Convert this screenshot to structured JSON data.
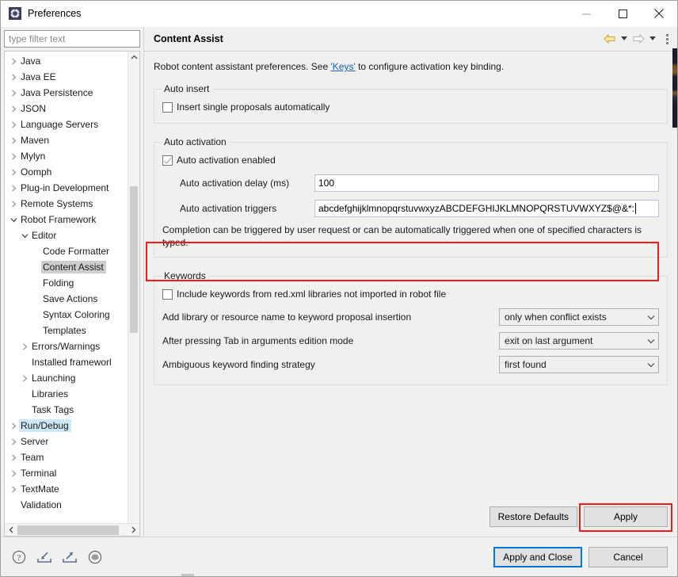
{
  "window": {
    "title": "Preferences",
    "icon": "gear-icon",
    "controls": {
      "minimize": "—",
      "maximize": "□",
      "close": "✕"
    }
  },
  "sidebar": {
    "filter": {
      "placeholder": "type filter text",
      "value": ""
    },
    "items": [
      {
        "label": "Java",
        "indent": 0,
        "twisty": "collapsed",
        "state": "normal"
      },
      {
        "label": "Java EE",
        "indent": 0,
        "twisty": "collapsed",
        "state": "normal"
      },
      {
        "label": "Java Persistence",
        "indent": 0,
        "twisty": "collapsed",
        "state": "normal"
      },
      {
        "label": "JSON",
        "indent": 0,
        "twisty": "collapsed",
        "state": "normal"
      },
      {
        "label": "Language Servers",
        "indent": 0,
        "twisty": "collapsed",
        "state": "normal"
      },
      {
        "label": "Maven",
        "indent": 0,
        "twisty": "collapsed",
        "state": "normal"
      },
      {
        "label": "Mylyn",
        "indent": 0,
        "twisty": "collapsed",
        "state": "normal"
      },
      {
        "label": "Oomph",
        "indent": 0,
        "twisty": "collapsed",
        "state": "normal"
      },
      {
        "label": "Plug-in Development",
        "indent": 0,
        "twisty": "collapsed",
        "state": "normal"
      },
      {
        "label": "Remote Systems",
        "indent": 0,
        "twisty": "collapsed",
        "state": "normal"
      },
      {
        "label": "Robot Framework",
        "indent": 0,
        "twisty": "expanded",
        "state": "normal"
      },
      {
        "label": "Editor",
        "indent": 1,
        "twisty": "expanded",
        "state": "normal"
      },
      {
        "label": "Code Formatter",
        "indent": 2,
        "twisty": "none",
        "state": "normal"
      },
      {
        "label": "Content Assist",
        "indent": 2,
        "twisty": "none",
        "state": "selected"
      },
      {
        "label": "Folding",
        "indent": 2,
        "twisty": "none",
        "state": "normal"
      },
      {
        "label": "Save Actions",
        "indent": 2,
        "twisty": "none",
        "state": "normal"
      },
      {
        "label": "Syntax Coloring",
        "indent": 2,
        "twisty": "none",
        "state": "normal"
      },
      {
        "label": "Templates",
        "indent": 2,
        "twisty": "none",
        "state": "normal"
      },
      {
        "label": "Errors/Warnings",
        "indent": 1,
        "twisty": "collapsed",
        "state": "normal"
      },
      {
        "label": "Installed frameworl",
        "indent": 1,
        "twisty": "none",
        "state": "normal"
      },
      {
        "label": "Launching",
        "indent": 1,
        "twisty": "collapsed",
        "state": "normal"
      },
      {
        "label": "Libraries",
        "indent": 1,
        "twisty": "none",
        "state": "normal"
      },
      {
        "label": "Task Tags",
        "indent": 1,
        "twisty": "none",
        "state": "normal"
      },
      {
        "label": "Run/Debug",
        "indent": 0,
        "twisty": "collapsed",
        "state": "focused"
      },
      {
        "label": "Server",
        "indent": 0,
        "twisty": "collapsed",
        "state": "normal"
      },
      {
        "label": "Team",
        "indent": 0,
        "twisty": "collapsed",
        "state": "normal"
      },
      {
        "label": "Terminal",
        "indent": 0,
        "twisty": "collapsed",
        "state": "normal"
      },
      {
        "label": "TextMate",
        "indent": 0,
        "twisty": "collapsed",
        "state": "normal"
      },
      {
        "label": "Validation",
        "indent": 0,
        "twisty": "none",
        "state": "normal"
      }
    ]
  },
  "page": {
    "title": "Content Assist",
    "nav": {
      "back": "back-arrow-icon",
      "back_menu": "chevron-down-icon",
      "forward": "forward-arrow-icon",
      "forward_menu": "chevron-down-icon",
      "view_menu": "view-menu-icon"
    },
    "intro": {
      "before": "Robot content assistant preferences. See ",
      "link": "'Keys'",
      "after": " to configure activation key binding."
    },
    "auto_insert": {
      "legend": "Auto insert",
      "checkbox": {
        "label": "Insert single proposals automatically",
        "checked": false
      }
    },
    "auto_activation": {
      "legend": "Auto activation",
      "enabled": {
        "label": "Auto activation enabled",
        "checked": true
      },
      "delay": {
        "label": "Auto activation delay (ms)",
        "value": "100"
      },
      "triggers": {
        "label": "Auto activation triggers",
        "value": "abcdefghijklmnopqrstuvwxyzABCDEFGHIJKLMNOPQRSTUVWXYZ$@&*:"
      },
      "hint": "Completion can be triggered by user request or can be automatically triggered when one of specified characters is typed."
    },
    "keywords": {
      "legend": "Keywords",
      "include": {
        "label": "Include keywords from red.xml libraries not imported in robot file",
        "checked": false
      },
      "rows": [
        {
          "label": "Add library or resource name to keyword proposal insertion",
          "value": "only when conflict exists"
        },
        {
          "label": "After pressing Tab in arguments edition mode",
          "value": "exit on last argument"
        },
        {
          "label": "Ambiguous keyword finding strategy",
          "value": "first found"
        }
      ]
    },
    "buttons": {
      "restore_defaults": "Restore Defaults",
      "apply": "Apply"
    }
  },
  "footer": {
    "icons": [
      "help-icon",
      "import-icon",
      "export-icon",
      "record-icon"
    ],
    "apply_and_close": "Apply and Close",
    "cancel": "Cancel"
  },
  "annotations": {
    "highlight_color": "#ef1c1c",
    "boxes": [
      "auto-activation-triggers-row",
      "apply-button"
    ]
  }
}
